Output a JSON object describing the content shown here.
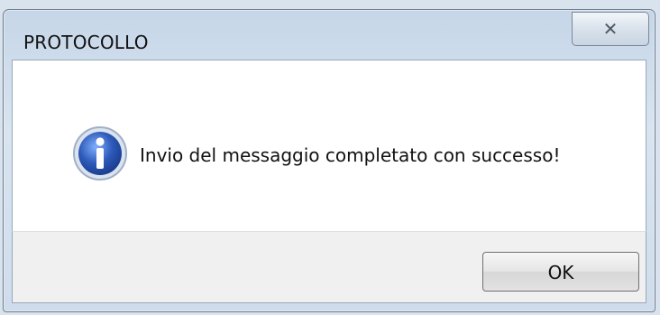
{
  "window": {
    "title": "PROTOCOLLO",
    "close_label": "✕"
  },
  "dialog": {
    "icon": "info-icon",
    "message": "Invio del messaggio completato con successo!",
    "ok_label": "OK"
  },
  "colors": {
    "frame": "#c9d8ea",
    "content_bg": "#ffffff",
    "footer_bg": "#f0f0f0",
    "icon_blue": "#2d59b8"
  }
}
